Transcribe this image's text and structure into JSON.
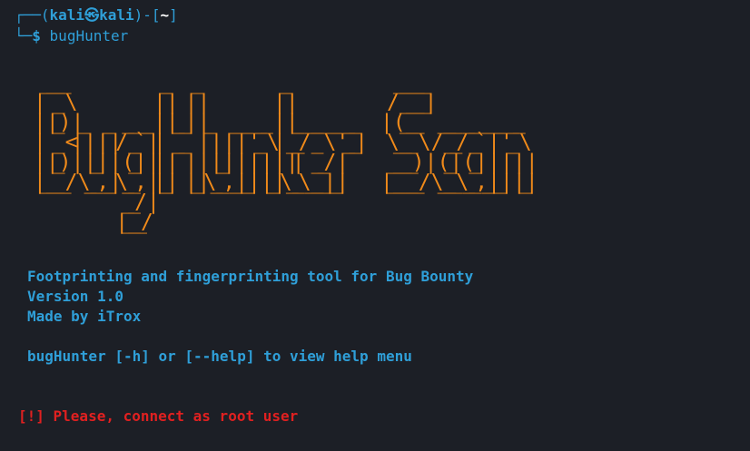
{
  "terminal": {
    "prompt": {
      "frame_left": "┌──(",
      "user": "kali",
      "at_symbol": "㉿",
      "host": "kali",
      "frame_mid": ")-[",
      "cwd": "~",
      "frame_right": "]",
      "frame_bottom": "└─",
      "dollar": "$",
      "command": "bugHunter"
    },
    "banner_ascii": "  ____               _    _             _                 _____                 \n |  _ \\             | |  | |           | |               / ____|                \n | |_) |_   _  __ _ | |__| |_   _ _ __ | |_ ___ _ __    | (___   ___ __ _ _ __  \n |  _ <| | | |/ _` ||  __  | | | | '_ \\| __/ _ \\ '__|    \\___ \\ / __/ _` | '_ \\ \n | |_) | |_| | (_| || |  | | |_| | | | | ||  __/ |       ____) | (_| (_| | | | |\n |____/ \\__,_|\\__, ||_|  |_|\\__,_|_| |_|\\__\\___|_|      |_____/ \\___\\__,_|_| |_|\n               __/ |                                                            \n              |___/                                                             ",
    "info": {
      "description": "Footprinting and fingerprinting tool for Bug Bounty",
      "version": "Version 1.0",
      "author": "Made by iTrox",
      "help_hint": "bugHunter [-h] or [--help] to view help menu"
    },
    "error": "[!] Please, connect as root user"
  },
  "colors": {
    "background": "#1c1f26",
    "prompt_blue": "#2f9fd8",
    "banner_orange": "#f08a1a",
    "error_red": "#e02020"
  }
}
